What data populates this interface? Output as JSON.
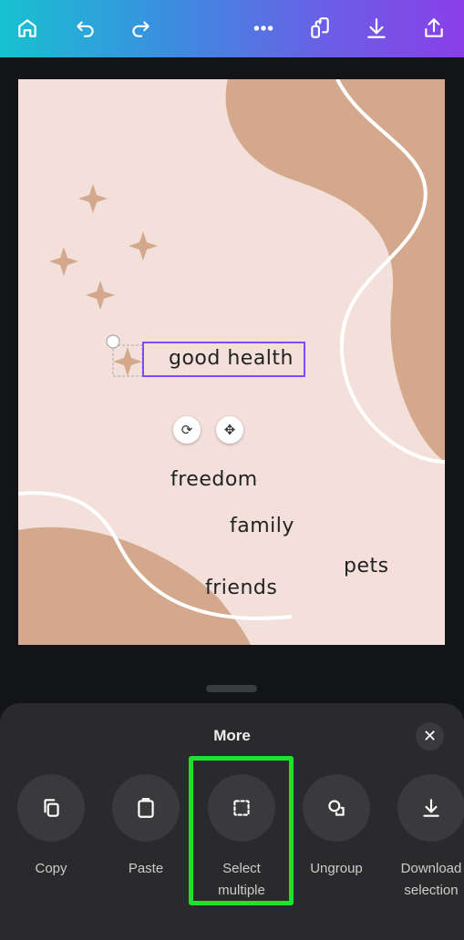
{
  "toolbar": {
    "icons": [
      "home-icon",
      "undo-icon",
      "redo-icon",
      "more-icon",
      "pages-icon",
      "download-icon",
      "share-icon"
    ]
  },
  "canvas": {
    "selected_text": "good health",
    "words": [
      "freedom",
      "family",
      "pets",
      "friends"
    ],
    "colors": {
      "background": "#f3e0da",
      "accent": "#d4a88c",
      "selection": "#7c4dff"
    }
  },
  "sheet": {
    "title": "More",
    "items": [
      {
        "label": "Copy",
        "icon": "copy-icon"
      },
      {
        "label": "Paste",
        "icon": "paste-icon"
      },
      {
        "label": "Select\nmultiple",
        "icon": "select-multiple-icon",
        "highlighted": true
      },
      {
        "label": "Ungroup",
        "icon": "ungroup-icon"
      },
      {
        "label": "Download\nselection",
        "icon": "download-icon"
      }
    ],
    "highlight_color": "#22e030"
  }
}
